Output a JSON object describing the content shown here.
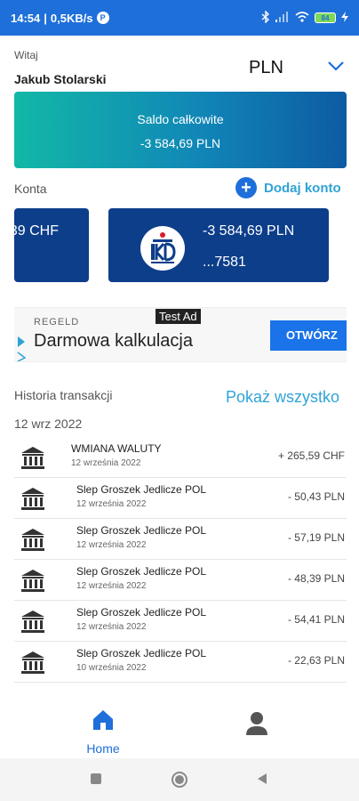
{
  "status_bar": {
    "time": "14:54",
    "speed": "0,5KB/s",
    "notif_glyph": "P",
    "battery": "84"
  },
  "header": {
    "welcome": "Witaj",
    "user_name": "Jakub Stolarski",
    "currency": "PLN"
  },
  "balance": {
    "label": "Saldo całkowite",
    "value": "-3 584,69 PLN"
  },
  "accounts": {
    "label": "Konta",
    "add_label": "Dodaj konto",
    "add_glyph": "+",
    "cards": [
      {
        "amount": "39 CHF"
      },
      {
        "amount": "-3 584,69 PLN",
        "number": "...7581"
      }
    ]
  },
  "ad": {
    "badge": "Test Ad",
    "source": "REGELD",
    "title": "Darmowa kalkulacja",
    "cta": "OTWÓRZ"
  },
  "history": {
    "label": "Historia transakcji",
    "show_all": "Pokaż wszystko",
    "date_group": "12 wrz 2022",
    "transactions": [
      {
        "name": "WMIANA WALUTY",
        "date": "12 września 2022",
        "amount": "+ 265,59 CHF"
      },
      {
        "name": "Slep Groszek Jedlicze POL",
        "date": "12 września 2022",
        "amount": "- 50,43 PLN"
      },
      {
        "name": "Slep Groszek Jedlicze POL",
        "date": "12 września 2022",
        "amount": "- 57,19 PLN"
      },
      {
        "name": "Slep Groszek Jedlicze POL",
        "date": "12 września 2022",
        "amount": "- 48,39 PLN"
      },
      {
        "name": "Slep Groszek Jedlicze POL",
        "date": "12 września 2022",
        "amount": "- 54,41 PLN"
      },
      {
        "name": "Slep Groszek Jedlicze POL",
        "date": "10 września 2022",
        "amount": "- 22,63 PLN"
      }
    ]
  },
  "nav": {
    "home_label": "Home"
  },
  "colors": {
    "primary": "#1e6fd9",
    "accent": "#2fa3d6",
    "card": "#0d3e8a"
  }
}
